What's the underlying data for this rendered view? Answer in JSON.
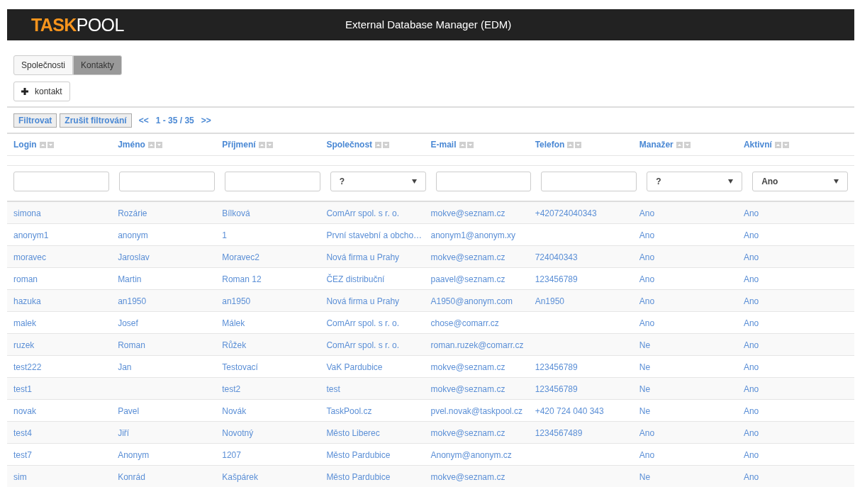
{
  "header": {
    "logo_bold": "TASK",
    "logo_light": "POOL",
    "title": "External Database Manager (EDM)"
  },
  "tabs": [
    {
      "label": "Společnosti",
      "selected": false
    },
    {
      "label": "Kontakty",
      "selected": true
    }
  ],
  "add_button": {
    "label": "kontakt"
  },
  "toolbar": {
    "filter_button": "Filtrovat",
    "clear_button": "Zrušit filtrování",
    "prev": "<<",
    "range": "1 - 35 / 35",
    "next": ">>"
  },
  "table": {
    "columns": [
      {
        "label": "Login",
        "filter": {
          "kind": "text"
        }
      },
      {
        "label": "Jméno",
        "filter": {
          "kind": "text"
        }
      },
      {
        "label": "Příjmení",
        "filter": {
          "kind": "text"
        }
      },
      {
        "label": "Společnost",
        "filter": {
          "kind": "select",
          "value": "?"
        }
      },
      {
        "label": "E-mail",
        "filter": {
          "kind": "text"
        }
      },
      {
        "label": "Telefon",
        "filter": {
          "kind": "text"
        }
      },
      {
        "label": "Manažer",
        "filter": {
          "kind": "select",
          "value": "?"
        }
      },
      {
        "label": "Aktivní",
        "filter": {
          "kind": "select",
          "value": "Ano"
        }
      }
    ],
    "rows": [
      [
        "simona",
        "Rozárie",
        "Bílková",
        "ComArr spol. s r. o.",
        "mokve@seznam.cz",
        "+420724040343",
        "Ano",
        "Ano"
      ],
      [
        "anonym1",
        "anonym",
        "1",
        "První stavební a obcho…",
        "anonym1@anonym.xy",
        null,
        "Ano",
        "Ano"
      ],
      [
        "moravec",
        "Jaroslav",
        "Moravec2",
        "Nová firma u Prahy",
        "mokve@seznam.cz",
        "724040343",
        "Ano",
        "Ano"
      ],
      [
        "roman",
        "Martin",
        "Roman 12",
        "ČEZ distribuční",
        "paavel@seznam.cz",
        "123456789",
        "Ano",
        "Ano"
      ],
      [
        "hazuka",
        "an1950",
        "an1950",
        "Nová firma u Prahy",
        "A1950@anonym.com",
        "An1950",
        "Ano",
        "Ano"
      ],
      [
        "malek",
        "Josef",
        "Málek",
        "ComArr spol. s r. o.",
        "chose@comarr.cz",
        null,
        "Ano",
        "Ano"
      ],
      [
        "ruzek",
        "Roman",
        "Růžek",
        "ComArr spol. s r. o.",
        "roman.ruzek@comarr.cz",
        null,
        "Ne",
        "Ano"
      ],
      [
        "test222",
        "Jan",
        "Testovací",
        "VaK Pardubice",
        "mokve@seznam.cz",
        "123456789",
        "Ne",
        "Ano"
      ],
      [
        "test1",
        null,
        "test2",
        "test",
        "mokve@seznam.cz",
        "123456789",
        "Ne",
        "Ano"
      ],
      [
        "novak",
        "Pavel",
        "Novák",
        "TaskPool.cz",
        "pvel.novak@taskpool.cz",
        "+420 724 040 343",
        "Ne",
        "Ano"
      ],
      [
        "test4",
        "Jiří",
        "Novotný",
        "Město Liberec",
        "mokve@seznam.cz",
        "1234567489",
        "Ano",
        "Ano"
      ],
      [
        "test7",
        "Anonym",
        "1207",
        "Město Pardubice",
        "Anonym@anonym.cz",
        null,
        "Ano",
        "Ano"
      ],
      [
        "sim",
        "Konrád",
        "Kašpárek",
        "Město Pardubice",
        "mokve@seznam.cz",
        null,
        "Ne",
        "Ano"
      ]
    ]
  }
}
